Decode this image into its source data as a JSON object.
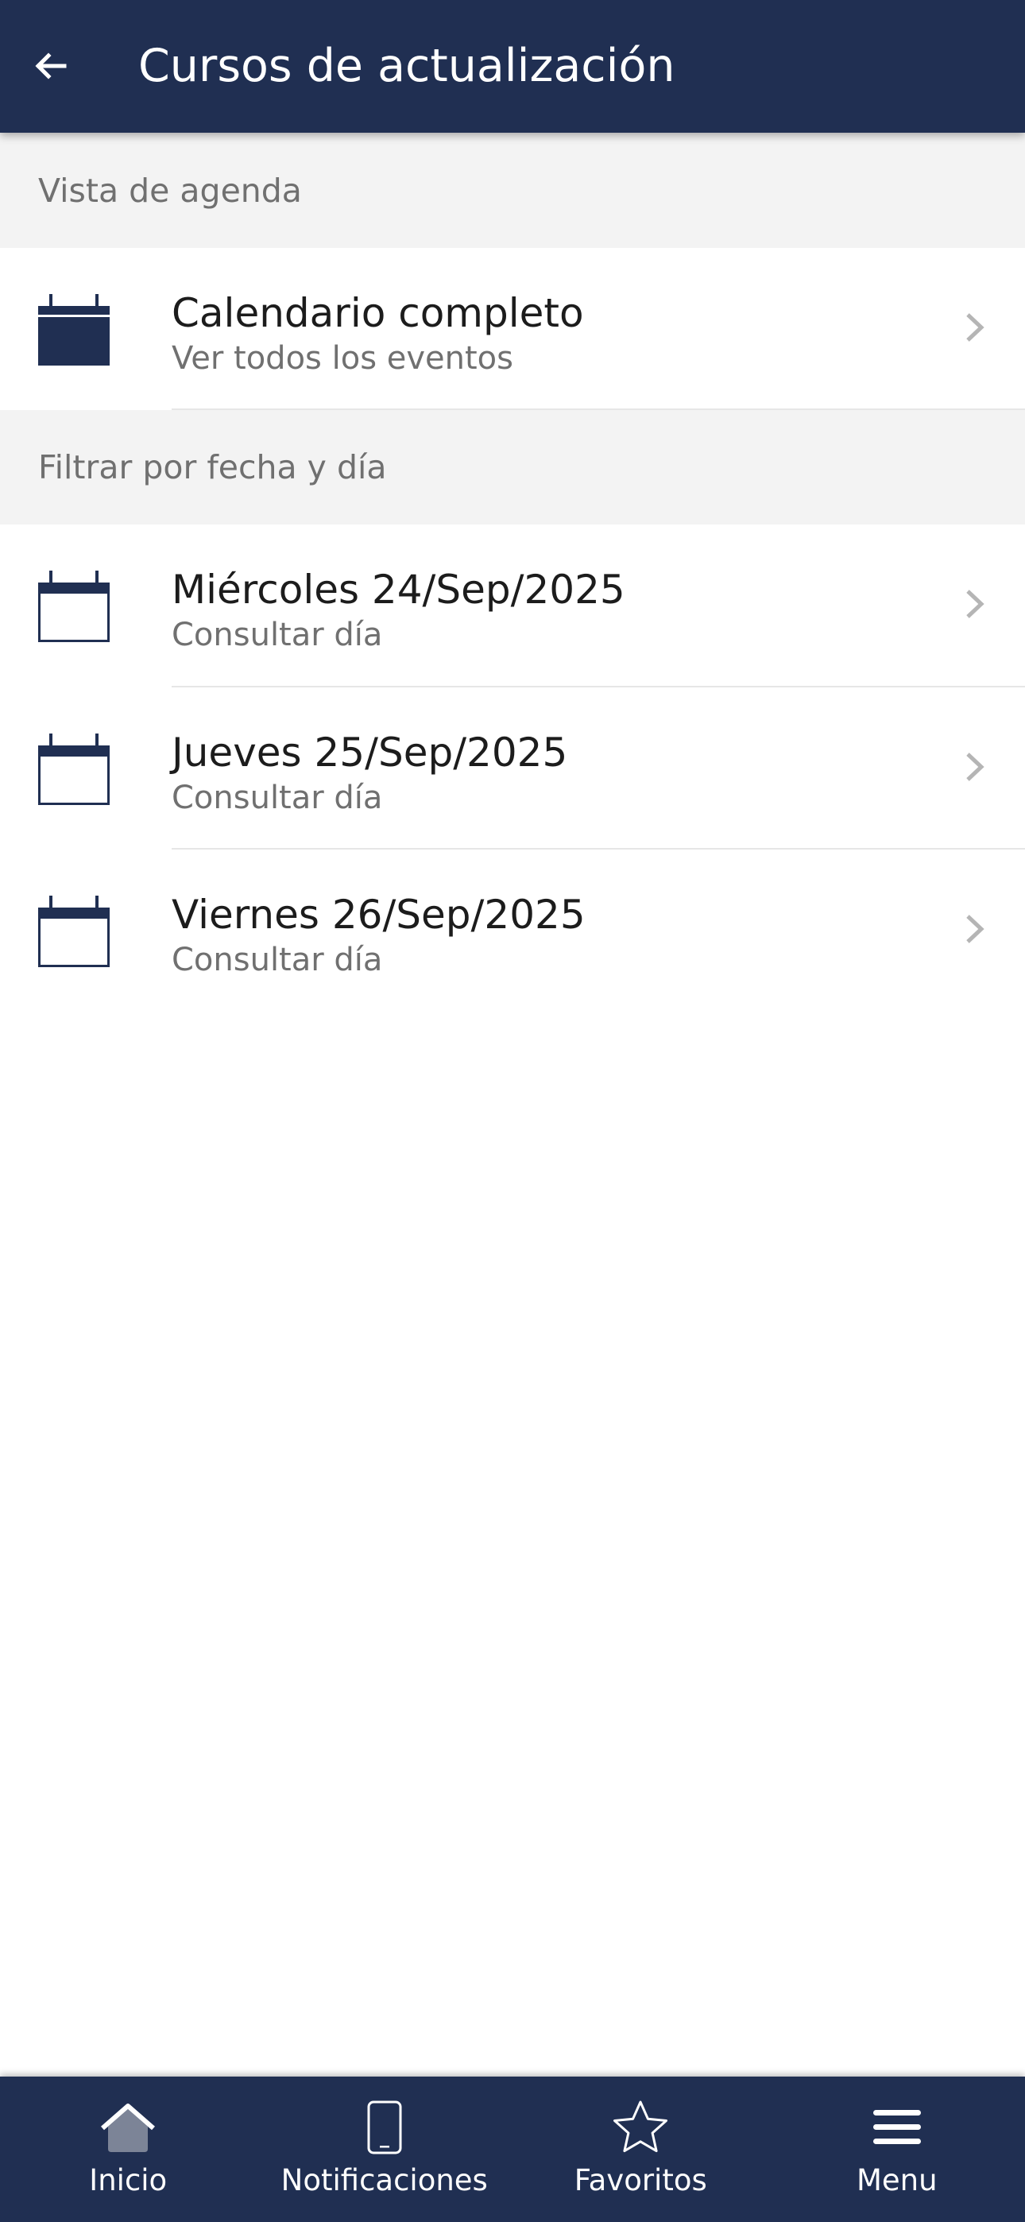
{
  "header": {
    "title": "Cursos de actualización",
    "back_icon": "arrow-left-icon"
  },
  "colors": {
    "primary": "#202f52",
    "section_bg": "#f3f3f3",
    "secondary_text": "#707070",
    "chevron": "#b5b5b5"
  },
  "sections": [
    {
      "header": "Vista de agenda",
      "items": [
        {
          "title": "Calendario completo",
          "subtitle": "Ver todos los eventos",
          "icon": "calendar-filled-icon"
        }
      ]
    },
    {
      "header": "Filtrar por fecha y día",
      "items": [
        {
          "title": "Miércoles 24/Sep/2025",
          "subtitle": "Consultar día",
          "icon": "calendar-outline-icon"
        },
        {
          "title": "Jueves 25/Sep/2025",
          "subtitle": "Consultar día",
          "icon": "calendar-outline-icon"
        },
        {
          "title": "Viernes 26/Sep/2025",
          "subtitle": "Consultar día",
          "icon": "calendar-outline-icon"
        }
      ]
    }
  ],
  "bottom_nav": [
    {
      "label": "Inicio",
      "icon": "home-icon"
    },
    {
      "label": "Notificaciones",
      "icon": "phone-icon"
    },
    {
      "label": "Favoritos",
      "icon": "star-icon"
    },
    {
      "label": "Menu",
      "icon": "menu-icon"
    }
  ]
}
